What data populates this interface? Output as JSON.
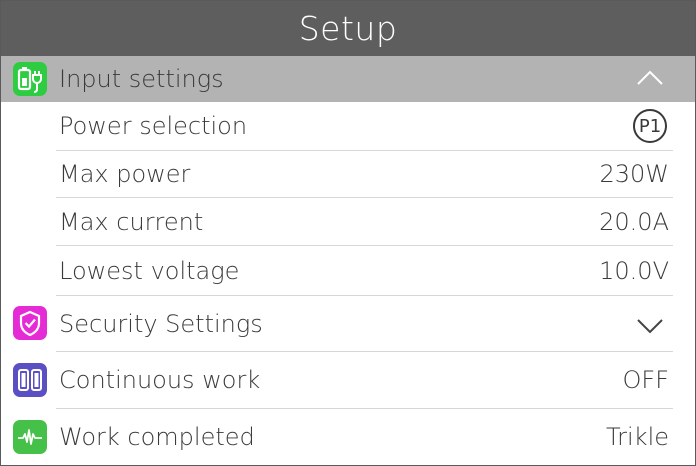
{
  "header": {
    "title": "Setup"
  },
  "sections": {
    "input": {
      "label": "Input settings",
      "icon": "plug-battery-icon",
      "color": "#2ecc40",
      "items": [
        {
          "label": "Power selection",
          "value": "P1"
        },
        {
          "label": "Max power",
          "value": "230W"
        },
        {
          "label": "Max current",
          "value": "20.0A"
        },
        {
          "label": "Lowest voltage",
          "value": "10.0V"
        }
      ]
    },
    "security": {
      "label": "Security Settings",
      "icon": "shield-check-icon",
      "color": "#e52bd6"
    },
    "continuous": {
      "label": "Continuous work",
      "value": "OFF",
      "icon": "batteries-icon",
      "color": "#5b4fc4"
    },
    "completed": {
      "label": "Work completed",
      "value": "Trikle",
      "icon": "waveform-icon",
      "color": "#45c048"
    }
  }
}
